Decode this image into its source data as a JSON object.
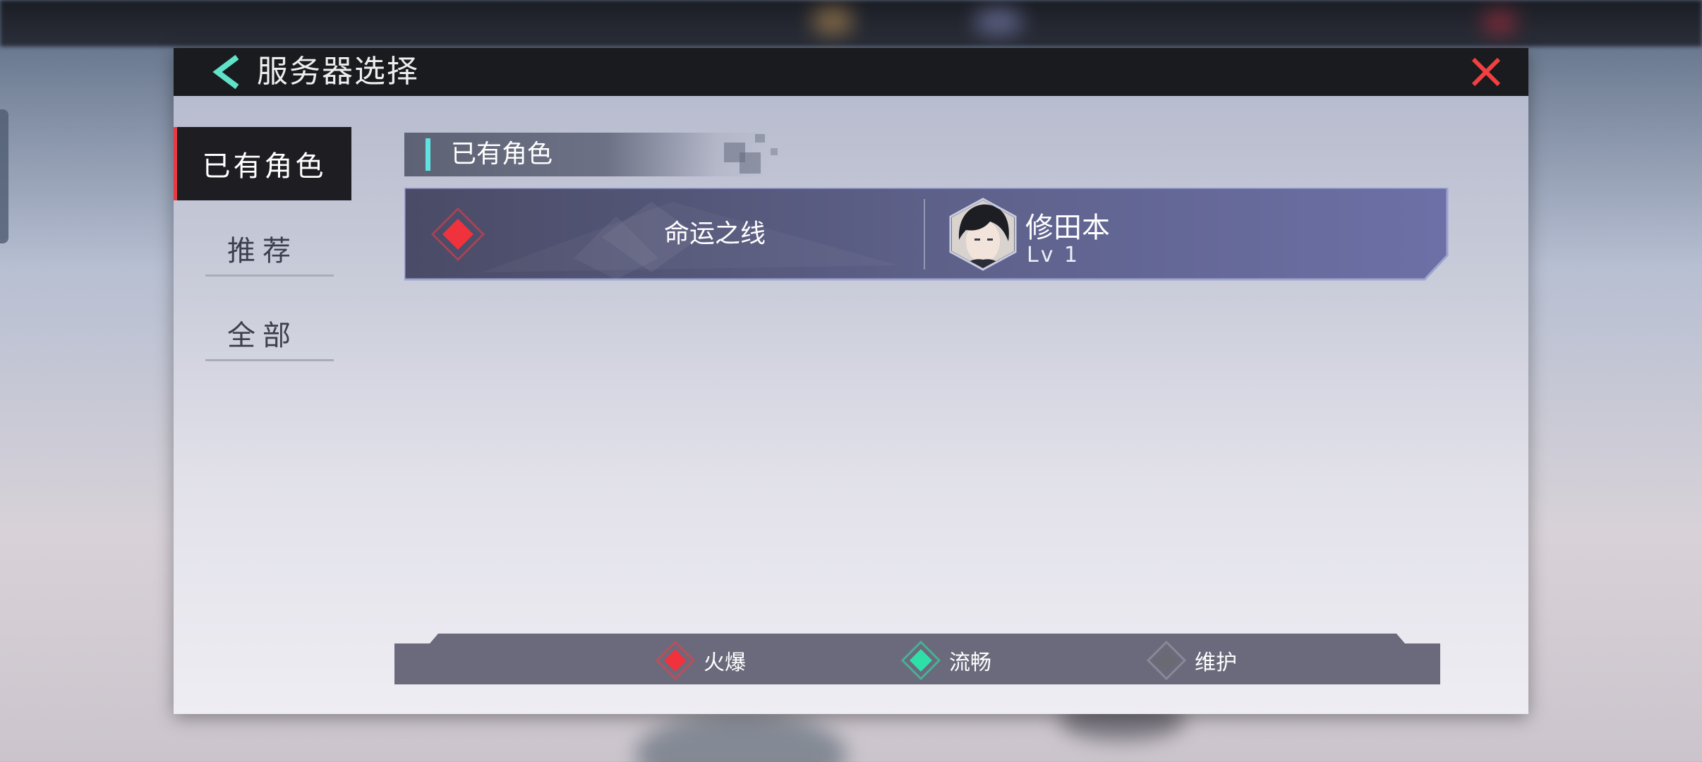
{
  "dialog": {
    "title": "服务器选择"
  },
  "tabs": [
    {
      "label": "已有角色",
      "active": true
    },
    {
      "label": "推荐",
      "active": false
    },
    {
      "label": "全部",
      "active": false
    }
  ],
  "section": {
    "header": "已有角色"
  },
  "servers": [
    {
      "name": "命运之线",
      "status": "hot",
      "character": {
        "name": "修田本",
        "level": "Lv 1"
      }
    }
  ],
  "legend": [
    {
      "label": "火爆",
      "color": "#f0323c"
    },
    {
      "label": "流畅",
      "color": "#2ee0a8"
    },
    {
      "label": "维护",
      "color": "#6a6a72"
    }
  ],
  "colors": {
    "accent_cyan": "#5fe2e2",
    "close_red": "#f04040",
    "active_tab_marker": "#e83a44",
    "row_bg": "#6a6e9e"
  }
}
